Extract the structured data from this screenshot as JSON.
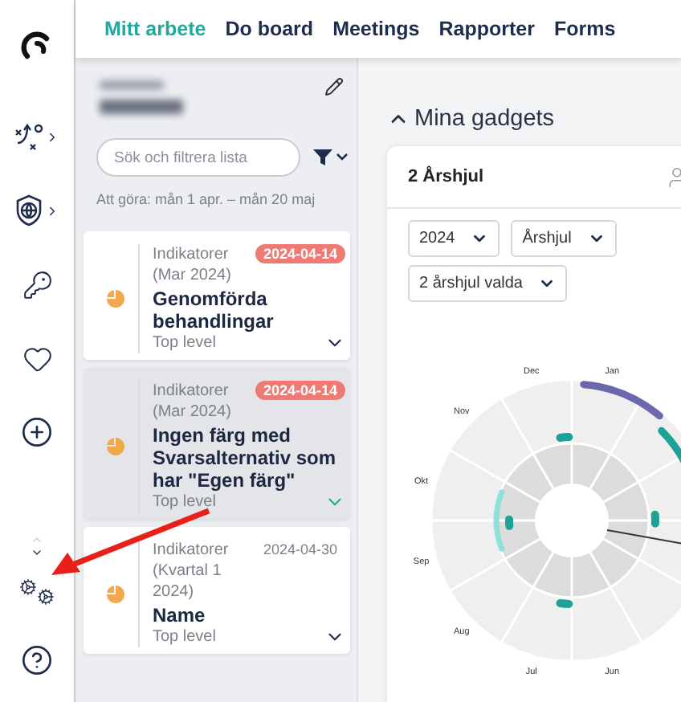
{
  "nav": {
    "tabs": [
      {
        "label": "Mitt arbete",
        "selected": true
      },
      {
        "label": "Do board",
        "selected": false
      },
      {
        "label": "Meetings",
        "selected": false
      },
      {
        "label": "Rapporter",
        "selected": false
      },
      {
        "label": "Forms",
        "selected": false
      }
    ]
  },
  "list_panel": {
    "search": {
      "placeholder": "Sök och filtrera lista"
    },
    "period": "Att göra: mån 1 apr. – mån 20 maj",
    "items": [
      {
        "category": "Indikatorer (Mar 2024)",
        "title": "Genomförda behandlingar",
        "scope": "Top level",
        "date": "2024-04-14",
        "overdue": true,
        "highlighted": false
      },
      {
        "category": "Indikatorer (Mar 2024)",
        "title": "Ingen färg med Svarsalternativ som har \"Egen färg\"",
        "scope": "Top level",
        "date": "2024-04-14",
        "overdue": true,
        "highlighted": true
      },
      {
        "category": "Indikatorer (Kvartal 1 2024)",
        "title": "Name",
        "scope": "Top level",
        "date": "2024-04-30",
        "overdue": false,
        "highlighted": false
      }
    ]
  },
  "gadgets": {
    "title": "Mina gadgets",
    "expanded": true,
    "cards": [
      {
        "title": "2 Årshjul",
        "filters": [
          "2024",
          "Årshjul",
          "2 årshjul valda"
        ],
        "months": [
          "Jun",
          "Jul",
          "Aug",
          "Sep",
          "Okt",
          "Nov",
          "Dec",
          "Jan"
        ]
      }
    ]
  }
}
